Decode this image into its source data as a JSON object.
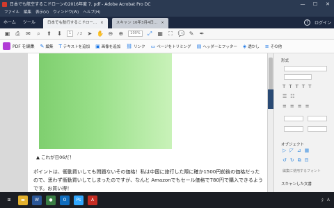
{
  "window": {
    "title": "日本でも航空するこドローンの2016年度 7. pdf - Adobe Acrobat Pro DC",
    "controls": [
      "—",
      "☐",
      "✕"
    ]
  },
  "menu": [
    "ファイル",
    "編集",
    "表示(V)",
    "ウィンドウ(W)",
    "ヘルプ(H)"
  ],
  "tabs": {
    "nav": [
      "ホーム",
      "ツール"
    ],
    "documents": [
      {
        "label": "日本でも航行するこドロー...",
        "close": "×",
        "active": true
      },
      {
        "label": "スキャン 16年3月4日...",
        "close": "×",
        "active": false
      }
    ],
    "help": "?",
    "signin": "ログイン"
  },
  "toolbar": {
    "page_current": "1",
    "page_total": "/ 2",
    "zoom": "100%"
  },
  "edit_toolbar": {
    "mode_label": "PDF を編集",
    "items": [
      {
        "icon": "✎",
        "label": "編集"
      },
      {
        "icon": "T",
        "label": "テキストを追加"
      },
      {
        "icon": "▣",
        "label": "画像を追加"
      },
      {
        "icon": "⛓",
        "label": "リンク"
      },
      {
        "icon": "▭",
        "label": "ページをトリミング"
      },
      {
        "icon": "▤",
        "label": "ヘッダーとフッター"
      },
      {
        "icon": "◈",
        "label": "透かし"
      },
      {
        "icon": "≡",
        "label": "その他"
      }
    ]
  },
  "document": {
    "caption": "▲ これが日06だ！",
    "body": "ポイントは、衝動買いしても問題ないその価格！私は中国に旅行した際に確か1500円前後の価格だったので、思わず衝動買いしてしまったのですが、なんと Amazonでもセール価格で780円で購入できるようです。お買い得！"
  },
  "right_panel": {
    "section_format": "形式",
    "section_objects": "オブジェクト",
    "section_scan": "スキャンした文書",
    "link_label": "編集に使用するフォント",
    "text_tools": [
      "T",
      "T",
      "T",
      "T",
      "T"
    ],
    "align_tools": [
      "≡",
      "≡",
      "≡",
      "≡"
    ],
    "object_tools": [
      "▷",
      "◸",
      "⊿",
      "▦"
    ]
  },
  "taskbar": {
    "items": [
      {
        "name": "windows",
        "glyph": "⊞",
        "color": "#1b1e24"
      },
      {
        "name": "explorer",
        "glyph": "▬",
        "color": "#e3b12e"
      },
      {
        "name": "word",
        "glyph": "W",
        "color": "#2b5797"
      },
      {
        "name": "chrome",
        "glyph": "●",
        "color": "#3a7d44"
      },
      {
        "name": "outlook",
        "glyph": "O",
        "color": "#0f6cbd"
      },
      {
        "name": "photoshop",
        "glyph": "Ps",
        "color": "#31a8ff"
      },
      {
        "name": "acrobat",
        "glyph": "A",
        "color": "#c52d24"
      }
    ],
    "tray": [
      "ﾀ",
      "A"
    ]
  }
}
